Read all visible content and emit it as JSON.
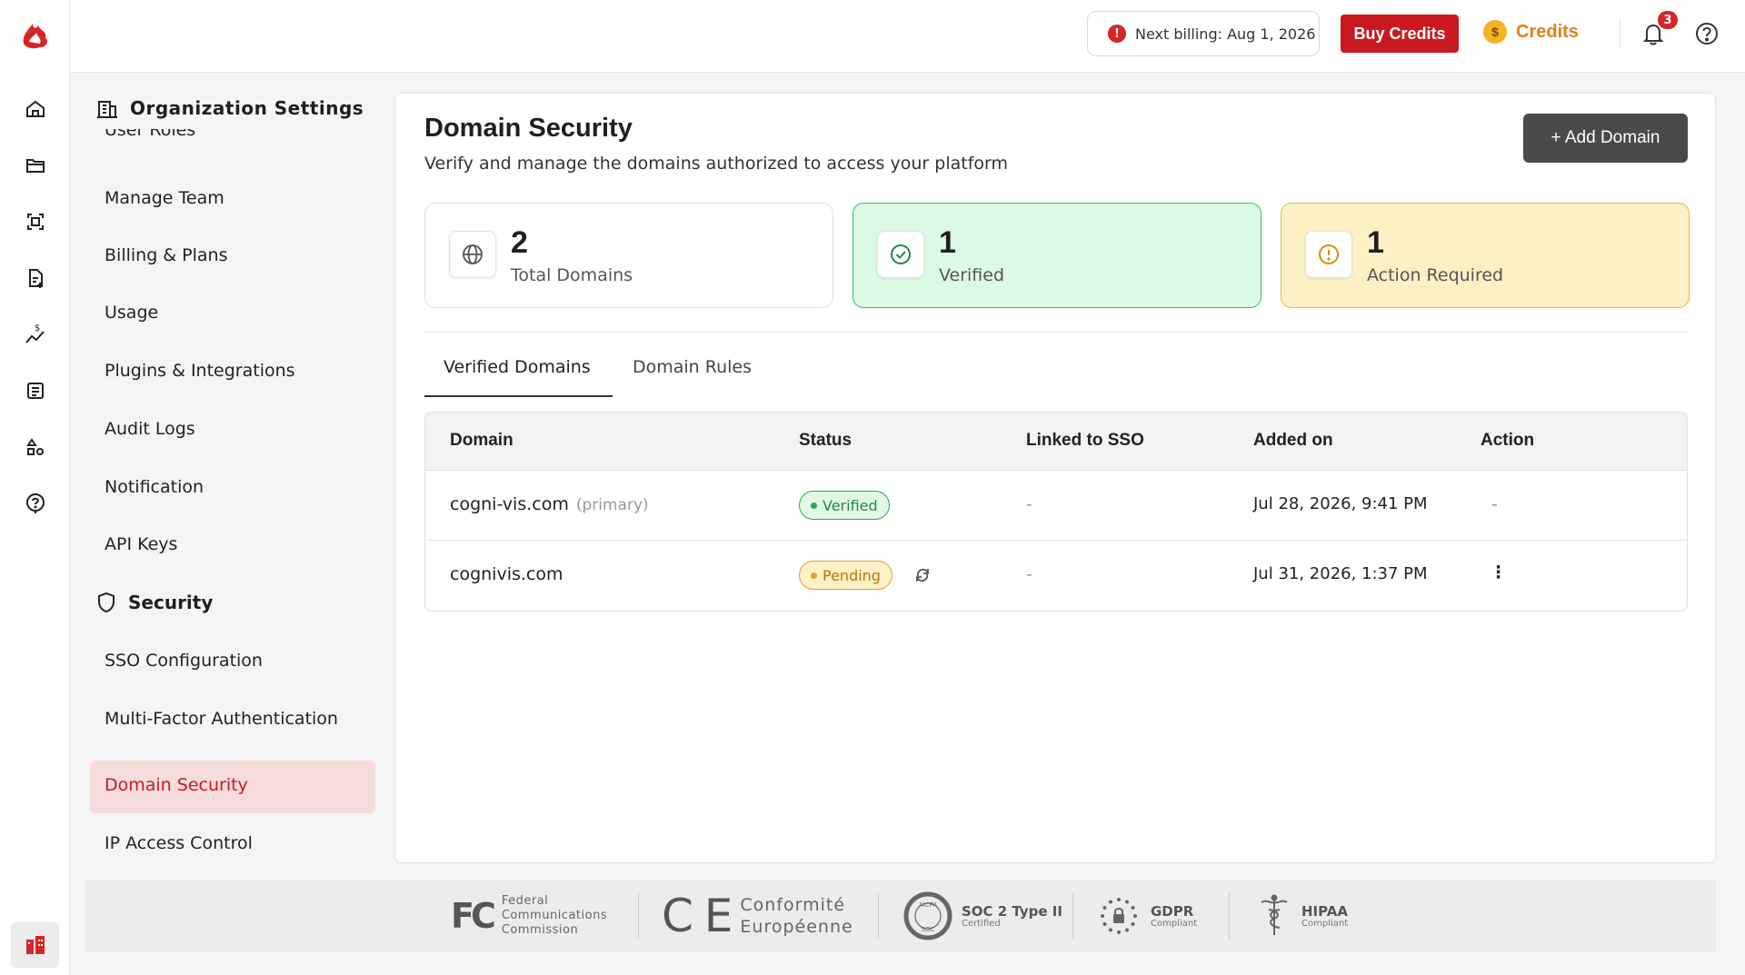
{
  "colors": {
    "brand": "#c9191f",
    "credits": "#e0811b",
    "verified": "#2fa655",
    "pending": "#e0a324"
  },
  "rail": {
    "logo": "flame-logo-icon",
    "items": [
      "home-icon",
      "folder-icon",
      "scan-icon",
      "document-add-icon",
      "cost-trend-icon",
      "list-icon",
      "shapes-icon",
      "help-circle-icon"
    ],
    "bottom": "organization-icon"
  },
  "topbar": {
    "billing_text": "Next billing: Aug 1, 2026",
    "billing_icon": "!",
    "buy_credits": "Buy Credits",
    "credits_label": "Credits",
    "credits_coin": "$",
    "notifications_count": "3"
  },
  "sidebar": {
    "title": "Organization Settings",
    "cut_item": "User Roles",
    "items": [
      "Manage Team",
      "Billing & Plans",
      "Usage",
      "Plugins & Integrations",
      "Audit Logs",
      "Notification",
      "API Keys"
    ],
    "security_title": "Security",
    "security_items": [
      "SSO Configuration",
      "Multi-Factor Authentication",
      "Domain Security",
      "IP Access Control"
    ]
  },
  "main": {
    "title": "Domain Security",
    "subtitle": "Verify and manage the domains authorized to access your platform",
    "add_button": "+ Add Domain",
    "stats": [
      {
        "value": "2",
        "label": "Total Domains"
      },
      {
        "value": "1",
        "label": "Verified"
      },
      {
        "value": "1",
        "label": "Action Required"
      }
    ],
    "tabs": [
      "Verified Domains",
      "Domain Rules"
    ],
    "table": {
      "headers": [
        "Domain",
        "Status",
        "Linked to SSO",
        "Added on",
        "Action"
      ],
      "rows": [
        {
          "domain": "cogni-vis.com",
          "tag": "(primary)",
          "status": "Verified",
          "sso": "-",
          "added": "Jul 28, 2026, 9:41 PM",
          "action": "-"
        },
        {
          "domain": "cognivis.com",
          "tag": "",
          "status": "Pending",
          "sso": "-",
          "added": "Jul 31, 2026, 1:37 PM",
          "action": "⋮"
        }
      ]
    }
  },
  "footer": {
    "fcc_mark": "FC",
    "fcc_lines": [
      "Federal",
      "Communications",
      "Commission"
    ],
    "ce_mark": "C E",
    "ce_lines": [
      "Conformité",
      "Européenne"
    ],
    "soc_ring_top": "AICPA",
    "soc_ring_bottom": "SOC",
    "soc_title": "SOC 2 Type II",
    "soc_sub": "Certified",
    "gdpr_title": "GDPR",
    "gdpr_sub": "Compliant",
    "hipaa_title": "HIPAA",
    "hipaa_sub": "Compliant"
  }
}
